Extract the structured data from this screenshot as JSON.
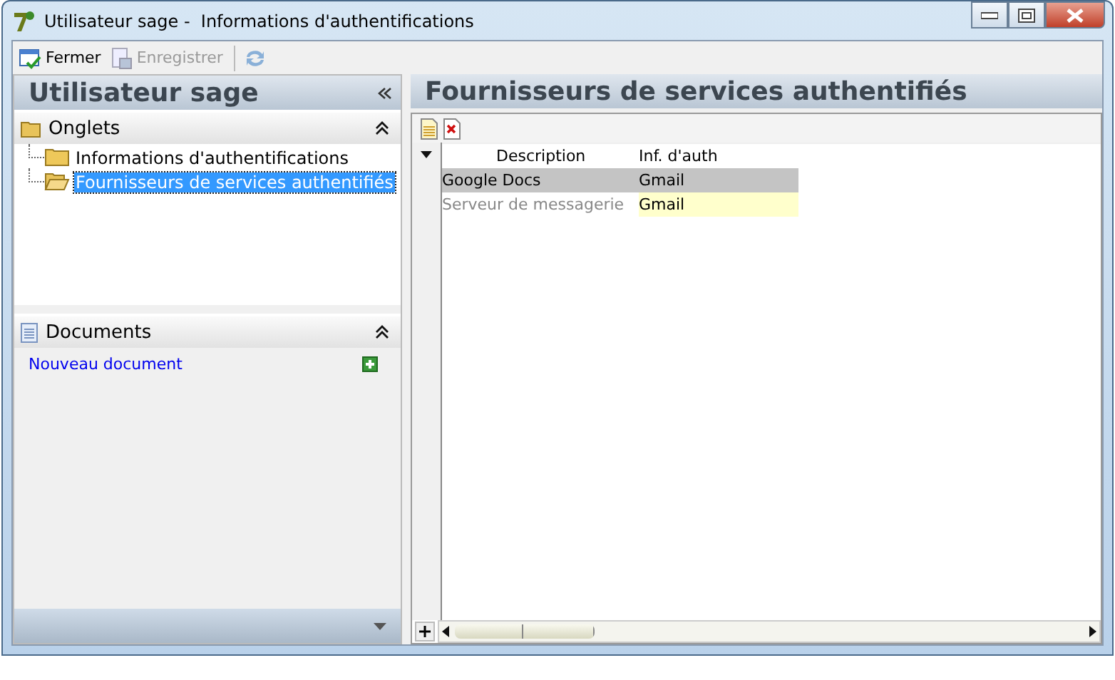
{
  "window": {
    "title": "Utilisateur sage -  Informations d'authentifications"
  },
  "toolbar": [
    {
      "label": "Fermer",
      "disabled": false
    },
    {
      "label": "Enregistrer",
      "disabled": true
    }
  ],
  "left_panel": {
    "title": "Utilisateur sage",
    "onglets": {
      "title": "Onglets",
      "expanded": true,
      "items": [
        {
          "label": "Informations d'authentifications",
          "selected": false
        },
        {
          "label": "Fournisseurs de services authentifiés",
          "selected": true
        }
      ]
    },
    "documents": {
      "title": "Documents",
      "expanded": true,
      "link": "Nouveau document"
    }
  },
  "right_panel": {
    "title": "Fournisseurs de services authentifiés",
    "table": {
      "columns": [
        "Description",
        "Inf. d'auth"
      ],
      "rows": [
        {
          "selected": true,
          "cells": [
            {
              "text": "Google Docs",
              "focused": false
            },
            {
              "text": "Gmail",
              "focused": false
            }
          ]
        },
        {
          "selected": false,
          "cells": [
            {
              "text": "Serveur de messagerie",
              "focused": false
            },
            {
              "text": "Gmail",
              "focused": true
            }
          ]
        }
      ]
    }
  }
}
